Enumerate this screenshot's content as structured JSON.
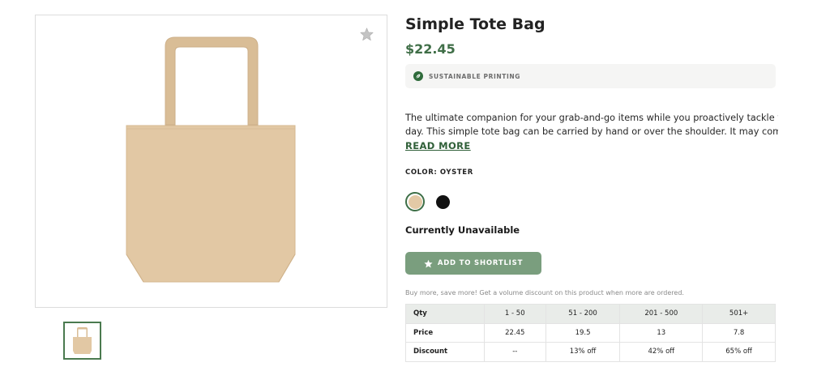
{
  "product": {
    "title": "Simple Tote Bag",
    "price": "$22.45",
    "badge": "SUSTAINABLE PRINTING",
    "description_line1": "The ultimate companion for your grab-and-go items while you proactively tackle your",
    "description_line2": "day. This simple tote bag can be carried by hand or over the shoulder. It may come i...",
    "read_more": "READ MORE",
    "color_label": "COLOR: OYSTER",
    "colors": [
      {
        "name": "Oyster",
        "hex": "#e3c9a6",
        "selected": true
      },
      {
        "name": "Black",
        "hex": "#111111",
        "selected": false
      }
    ],
    "availability": "Currently Unavailable",
    "shortlist_label": "ADD TO SHORTLIST"
  },
  "gallery": {
    "favorite_icon": "star-icon",
    "bag_color": "#e2c8a4"
  },
  "volume": {
    "note": "Buy more, save more! Get a volume discount on this product when more are ordered.",
    "headers": [
      "Qty",
      "1 - 50",
      "51 - 200",
      "201 - 500",
      "501+"
    ],
    "rows": [
      {
        "label": "Price",
        "cells": [
          "22.45",
          "19.5",
          "13",
          "7.8"
        ]
      },
      {
        "label": "Discount",
        "cells": [
          "--",
          "13% off",
          "42% off",
          "65% off"
        ]
      }
    ]
  },
  "colors": {
    "accent": "#3f6e47",
    "button": "#7a9e7e"
  }
}
